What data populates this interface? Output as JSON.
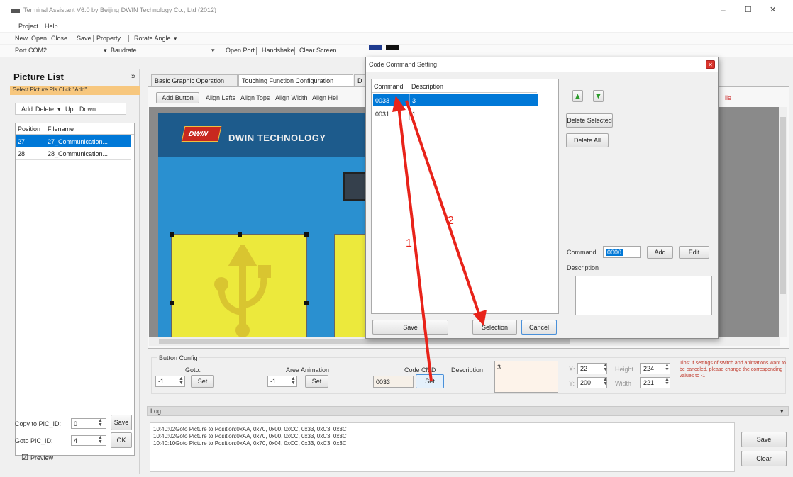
{
  "window": {
    "title": "Terminal Assistant V6.0 by Beijing DWIN Technology Co., Ltd (2012)",
    "min": "–",
    "max": "☐",
    "close": "✕"
  },
  "menu": {
    "project": "Project",
    "help": "Help"
  },
  "toolbar": {
    "new": "New",
    "open": "Open",
    "close": "Close",
    "save": "Save",
    "property": "Property",
    "rotate": "Rotate Angle",
    "rotate_arrow": "▾"
  },
  "portbar": {
    "port_label": "Port",
    "port_value": "COM2",
    "baud_label": "Baudrate",
    "open_port": "Open Port",
    "handshake": "Handshake",
    "clear_screen": "Clear Screen"
  },
  "picture_list": {
    "title": "Picture List",
    "collapse": "»",
    "hint": "Select Picture Pls Click \"Add\"",
    "add": "Add",
    "delete": "Delete",
    "up": "Up",
    "down": "Down",
    "columns": [
      "Position",
      "Filename"
    ],
    "rows": [
      {
        "position": "27",
        "filename": "27_Communication..."
      },
      {
        "position": "28",
        "filename": "28_Communication..."
      }
    ]
  },
  "bottom_left": {
    "copy_label": "Copy to PIC_ID:",
    "copy_value": "0",
    "copy_btn": "Save",
    "goto_label": "Goto PIC_ID:",
    "goto_value": "4",
    "goto_btn": "OK",
    "preview_label": "Preview",
    "preview_check": "☑"
  },
  "tabs": [
    "Basic Graphic Operation",
    "Touching Function Configuration",
    "D"
  ],
  "sub_toolbar": {
    "add_button": "Add Button",
    "align_lefts": "Align Lefts",
    "align_tops": "Align Tops",
    "align_width": "Align Width",
    "align_hei": "Align Hei"
  },
  "canvas": {
    "logo_text": "DWIN",
    "brand_text": "DWIN TECHNOLOGY",
    "right_label": "ile"
  },
  "config": {
    "button_config": "Button Config",
    "goto_label": "Goto:",
    "goto_value": "-1",
    "goto_set": "Set",
    "area_anim_label": "Area Animation",
    "area_anim_value": "-1",
    "area_anim_set": "Set",
    "code_cmd_label": "Code CMD",
    "code_cmd_value": "0033",
    "code_cmd_set": "Set",
    "description_label": "Description",
    "description_value": "3",
    "x_label": "X:",
    "x_value": "22",
    "height_label": "Height",
    "height_value": "224",
    "y_label": "Y:",
    "y_value": "200",
    "width_label": "Width",
    "width_value": "221",
    "tips": "Tips: If settings of switch and animations want to be canceled, please change the corresponding values to -1"
  },
  "log": {
    "title": "Log",
    "lines": [
      "10:40:02Goto Picture to Position:0xAA, 0x70, 0x00, 0xCC, 0x33, 0xC3, 0x3C",
      "10:40:02Goto Picture to Position:0xAA, 0x70, 0x00, 0xCC, 0x33, 0xC3, 0x3C",
      "10:40:10Goto Picture to Position:0xAA, 0x70, 0x04, 0xCC, 0x33, 0xC3, 0x3C"
    ],
    "save": "Save",
    "clear": "Clear"
  },
  "dialog": {
    "title": "Code Command Setting",
    "close": "✕",
    "columns": [
      "Command",
      "Description"
    ],
    "rows": [
      {
        "command": "0033",
        "description": "3"
      },
      {
        "command": "0031",
        "description": "1"
      }
    ],
    "delete_selected": "Delete Selected",
    "delete_all": "Delete All",
    "command_label": "Command",
    "command_value": "0000",
    "add": "Add",
    "edit": "Edit",
    "description_label": "Description",
    "save": "Save",
    "selection": "Selection",
    "cancel": "Cancel"
  },
  "annotations": {
    "one": "1",
    "two": "2",
    "color": "#e8231a"
  },
  "colors": {
    "accent": "#0078d7",
    "button_yellow": "#ece93c",
    "canvas_blue": "#2a90d0",
    "title_red": "#d9332b",
    "hint_orange": "#f7c77e"
  }
}
